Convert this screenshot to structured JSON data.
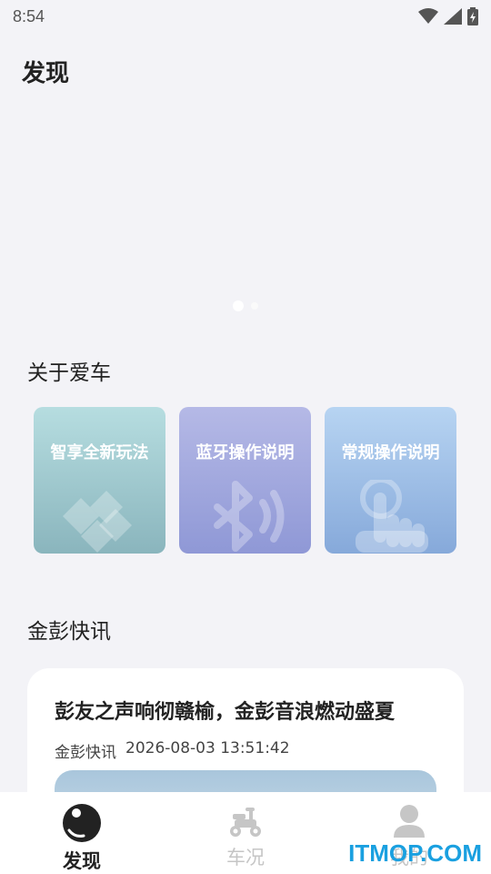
{
  "status_bar": {
    "time": "8:54",
    "icons": [
      "wifi-icon",
      "signal-icon",
      "battery-icon"
    ]
  },
  "page": {
    "title": "发现"
  },
  "banner": {
    "active_page": 1,
    "page_count": 2
  },
  "about_car": {
    "section_title": "关于爱车",
    "cards": [
      {
        "label": "智享全新玩法",
        "icon": "blocks-icon",
        "color": "#8fc0c8"
      },
      {
        "label": "蓝牙操作说明",
        "icon": "bluetooth-icon",
        "color": "#9aa2db"
      },
      {
        "label": "常规操作说明",
        "icon": "tap-hand-icon",
        "color": "#8fb2e0"
      }
    ]
  },
  "news": {
    "section_title": "金彭快讯",
    "items": [
      {
        "title": "彭友之声响彻赣榆，金彭音浪燃动盛夏",
        "source": "金彭快讯",
        "datetime": "2026-08-03 13:51:42"
      }
    ]
  },
  "tab_bar": {
    "tabs": [
      {
        "label": "发现",
        "icon": "discover-icon",
        "active": true
      },
      {
        "label": "车况",
        "icon": "scooter-icon",
        "active": false
      },
      {
        "label": "我的",
        "icon": "profile-icon",
        "active": false
      }
    ]
  },
  "watermark": "ITMOP.COM"
}
